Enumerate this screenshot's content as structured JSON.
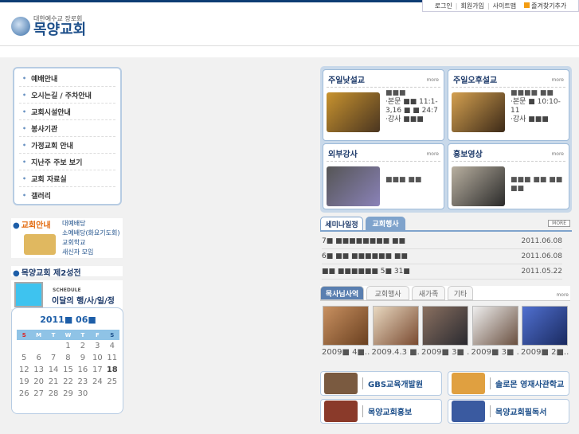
{
  "header": {
    "links": [
      "로그인",
      "회원가입",
      "사이트맵",
      "즐겨찾기추가"
    ],
    "logo_sub": "대한예수교 장로회",
    "logo_main": "목양교회"
  },
  "menu": [
    "예배안내",
    "오시는길 / 주차안내",
    "교회시설안내",
    "봉사기관",
    "가정교회 안내",
    "지난주 주보 보기",
    "교회 자료실",
    "갤러리"
  ],
  "info": {
    "title": "교회안내",
    "links": [
      "대예배당",
      "소예배당(화요기도회)",
      "교회학교",
      "새신자 모임"
    ]
  },
  "second_sanctuary": "목양교회 제2성전",
  "schedule": {
    "en": "SCHEDULE",
    "ko": "이달의 행/사/일/정"
  },
  "calendar": {
    "title": "2011■ 06■",
    "weekdays": [
      "S",
      "M",
      "T",
      "W",
      "T",
      "F",
      "S"
    ],
    "days": [
      "",
      "",
      "",
      "1",
      "2",
      "3",
      "4",
      "5",
      "6",
      "7",
      "8",
      "9",
      "10",
      "11",
      "12",
      "13",
      "14",
      "15",
      "16",
      "17",
      "18",
      "19",
      "20",
      "21",
      "22",
      "23",
      "24",
      "25",
      "26",
      "27",
      "28",
      "29",
      "30",
      "",
      ""
    ],
    "today": "18"
  },
  "sermons": [
    {
      "title": "주일낮설교",
      "more": "more",
      "lines": [
        "■■■",
        "·본문 ■■ 11:1-3,16 ■ ■ 24:7",
        "·강사 ■■■"
      ]
    },
    {
      "title": "주일오후설교",
      "more": "more",
      "lines": [
        "■■■■ ■■",
        "·본문 ■ 10:10-11",
        "·강사 ■■■"
      ]
    },
    {
      "title": "외부강사",
      "more": "more",
      "lines": [
        "■■■ ■■"
      ]
    },
    {
      "title": "홍보영상",
      "more": "more",
      "lines": [
        "■■■ ■■ ■■ ■■"
      ]
    }
  ],
  "seminar": {
    "tabs": [
      "세미나일정",
      "교회행사"
    ],
    "more": "MORE",
    "rows": [
      {
        "t": "7■ ■■■■■■■■ ■■",
        "d": "2011.06.08"
      },
      {
        "t": "6■ ■■ ■■■■■■ ■■",
        "d": "2011.06.08"
      },
      {
        "t": "■■ ■■■■■■ 5■ 31■",
        "d": "2011.05.22"
      }
    ]
  },
  "gallery": {
    "tabs": [
      "목사님사역",
      "교회행사",
      "새가족",
      "기타"
    ],
    "more": "more",
    "captions": [
      "2009■ 4■...",
      "2009.4.3 ■...",
      "2009■ 3■ ...",
      "2009■ 3■ ...",
      "2009■ 2■..."
    ]
  },
  "banners": [
    "GBS교육개발원",
    "솔로몬 영재사관학교",
    "목양교회홍보",
    "목양교회필독서"
  ],
  "colors": {
    "brand": "#1d4f8a",
    "accent": "#e36b10"
  }
}
